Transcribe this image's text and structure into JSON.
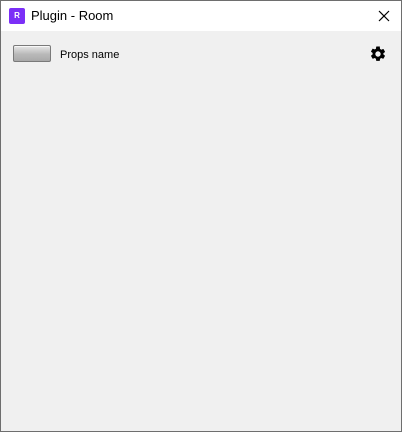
{
  "window": {
    "title": "Plugin - Room",
    "app_icon_letter": "R",
    "app_icon_color": "#7b2ff7"
  },
  "content": {
    "props_label": "Props name",
    "settings_icon": "gear-icon"
  }
}
